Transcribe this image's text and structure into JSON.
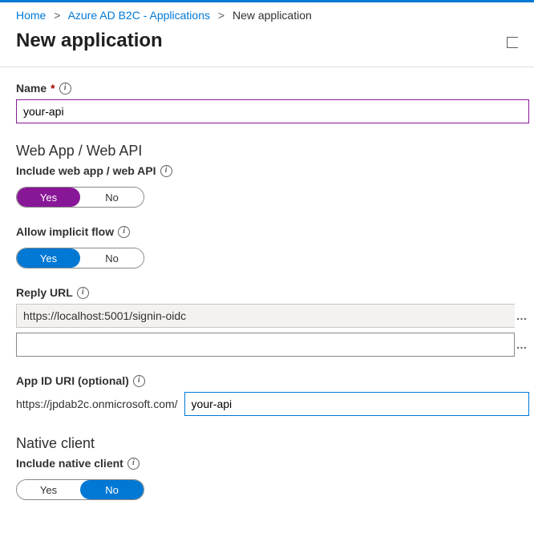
{
  "breadcrumb": {
    "home": "Home",
    "mid": "Azure AD B2C - Applications",
    "current": "New application"
  },
  "pageTitle": "New application",
  "name": {
    "label": "Name",
    "value": "your-api"
  },
  "webSection": {
    "heading": "Web App / Web API",
    "includeLabel": "Include web app / web API",
    "includeYes": "Yes",
    "includeNo": "No",
    "implicitLabel": "Allow implicit flow",
    "implicitYes": "Yes",
    "implicitNo": "No",
    "replyLabel": "Reply URL",
    "replyValue1": "https://localhost:5001/signin-oidc",
    "replyValue2": "",
    "appIdLabel": "App ID URI (optional)",
    "appIdPrefix": "https://jpdab2c.onmicrosoft.com/",
    "appIdValue": "your-api"
  },
  "nativeSection": {
    "heading": "Native client",
    "includeLabel": "Include native client",
    "yes": "Yes",
    "no": "No"
  }
}
